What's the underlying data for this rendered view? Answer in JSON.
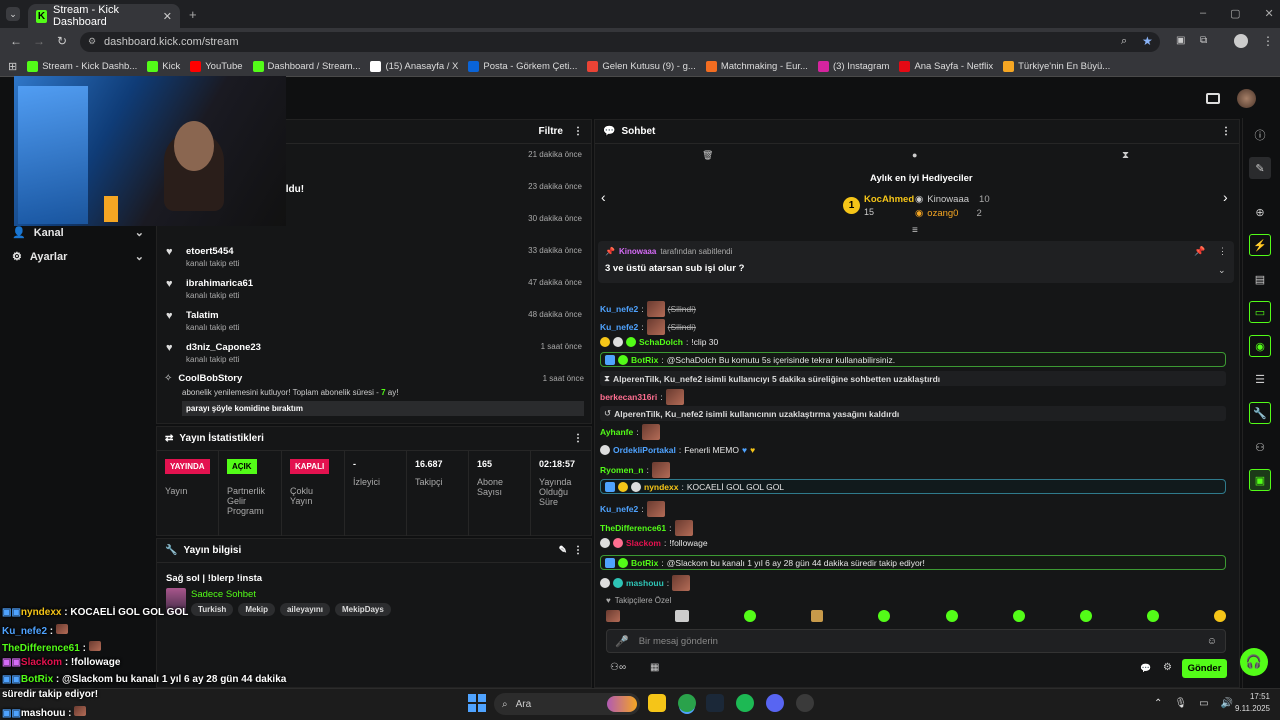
{
  "browser": {
    "tab_title": "Stream - Kick Dashboard",
    "url": "dashboard.kick.com/stream",
    "bookmarks": [
      {
        "label": "Stream - Kick Dashb...",
        "color": "#53fc18"
      },
      {
        "label": "Kick",
        "color": "#53fc18"
      },
      {
        "label": "YouTube",
        "color": "#ff0000"
      },
      {
        "label": "Dashboard / Stream...",
        "color": "#53fc18"
      },
      {
        "label": "(15) Anasayfa / X",
        "color": "#ffffff"
      },
      {
        "label": "Posta - Görkem Çeti...",
        "color": "#0a64d8"
      },
      {
        "label": "Gelen Kutusu (9) - g...",
        "color": "#ea4335"
      },
      {
        "label": "Matchmaking - Eur...",
        "color": "#f36d21"
      },
      {
        "label": "(3) Instagram",
        "color": "#d6249f"
      },
      {
        "label": "Ana Sayfa - Netflix",
        "color": "#e50914"
      },
      {
        "label": "Türkiye'nin En Büyü...",
        "color": "#f5a623"
      }
    ]
  },
  "sidebar": {
    "items": [
      {
        "label": "Kanal"
      },
      {
        "label": "Ayarlar"
      }
    ]
  },
  "activity": {
    "filter_label": "Filtre",
    "partial_title": "ıldu!",
    "rows": [
      {
        "user": "",
        "sub": "",
        "time": "21 dakika önce"
      },
      {
        "user": "",
        "sub": "",
        "time": "23 dakika önce"
      },
      {
        "user": "",
        "sub": "kanalı takip etti",
        "time": "30 dakika önce"
      },
      {
        "user": "etoert5454",
        "sub": "kanalı takip etti",
        "time": "33 dakika önce"
      },
      {
        "user": "ibrahimarica61",
        "sub": "kanalı takip etti",
        "time": "47 dakika önce"
      },
      {
        "user": "Talatim",
        "sub": "kanalı takip etti",
        "time": "48 dakika önce"
      },
      {
        "user": "d3niz_Capone23",
        "sub": "kanalı takip etti",
        "time": "1 saat önce"
      }
    ],
    "sub_row": {
      "user": "CoolBobStory",
      "text": "abonelik yenilemesini kutluyor! Toplam abonelik süresi - ",
      "months": "7",
      "suffix": " ay!",
      "time": "1 saat önce",
      "message": "parayı şöyle komidine bıraktım"
    }
  },
  "stats": {
    "title": "Yayın İstatistikleri",
    "cols": [
      {
        "badge": "YAYINDA",
        "label": "Yayın",
        "color": "#e3124f"
      },
      {
        "badge": "AÇIK",
        "label": "Partnerlik Gelir Programı",
        "color": "#53fc18"
      },
      {
        "badge": "KAPALI",
        "label": "Çoklu Yayın",
        "color": "#e3124f"
      },
      {
        "value": "-",
        "label": "İzleyici"
      },
      {
        "value": "16.687",
        "label": "Takipçi"
      },
      {
        "value": "165",
        "label": "Abone Sayısı"
      },
      {
        "value": "02:18:57",
        "label": "Yayında Olduğu Süre"
      }
    ]
  },
  "stream_info": {
    "title": "Yayın bilgisi",
    "stream_title": "Sağ sol | !blerp !insta",
    "category": "Sadece Sohbet",
    "tags": [
      "Turkish",
      "Mekip",
      "aileyayını",
      "MekipDays"
    ]
  },
  "chat": {
    "title": "Sohbet",
    "gifters_title": "Aylık en iyi Hediyeciler",
    "top_gifter": {
      "name": "KocAhmed",
      "count": "15",
      "rank": "1"
    },
    "gifter2": {
      "name": "Kinowaaa",
      "count": "10"
    },
    "gifter3": {
      "name": "ozang0",
      "count": "2"
    },
    "pinned_by": "Kinowaaa",
    "pinned_suffix": "tarafından sabitlendi",
    "pinned_text": "3 ve üstü atarsan sub işi olur ?",
    "deleted_label": "(Silindi)",
    "msgs": {
      "k1": "Ku_nefe2",
      "scha_user": "SchaDolch",
      "scha_text": "!clip 30",
      "botrix": "BotRix",
      "botrix1": "@SchaDolch Bu komutu 5s içerisinde tekrar kullanabilirsiniz.",
      "timeout_text": "AlperenTilk, Ku_nefe2 isimli kullanıcıyı 5 dakika süreliğine sohbetten uzaklaştırdı",
      "berke": "berkecan316ri",
      "untimeout_text": "AlperenTilk, Ku_nefe2 isimli kullanıcının uzaklaştırma yasağını kaldırdı",
      "ayhan": "Ayhanfe",
      "ordek_user": "OrdekliPortakal",
      "ordek_text": "Fenerli MEMO",
      "ryomen": "Ryomen_n",
      "nyndexx_user": "nyndexx",
      "nyndexx_text": "KOCAELİ GOL GOL GOL",
      "kunefe": "Ku_nefe2",
      "thedif": "TheDifference61",
      "slackom_user": "Slackom",
      "slackom_text": "!followage",
      "botrix2": "@Slackom bu kanalı 1 yıl 6 ay 28 gün 44 dakika süredir takip ediyor!",
      "mashouu": "mashouu"
    },
    "followers_only": "Takipçilere Özel",
    "input_placeholder": "Bir mesaj gönderin",
    "send_label": "Gönder"
  },
  "overlay": {
    "lines": [
      {
        "user": "nyndexx",
        "text": " : KOCAELİ GOL GOL GOL",
        "color": "#f5c518"
      },
      {
        "user": "Ku_nefe2",
        "text": " :",
        "color": "#4fa3ff"
      },
      {
        "user": "TheDifference61",
        "text": " :",
        "color": "#53fc18"
      },
      {
        "user": "Slackom",
        "text": " : !followage",
        "color": "#e3124f"
      },
      {
        "user": "BotRix",
        "text": " : @Slackom bu kanalı 1 yıl 6 ay 28 gün 44 dakika",
        "color": "#53fc18"
      },
      {
        "user": "",
        "text": "süredir takip ediyor!",
        "color": "#ffffff"
      },
      {
        "user": "mashouu",
        "text": " :",
        "color": "#fff"
      }
    ]
  },
  "taskbar": {
    "search": "Ara",
    "time": "17:51",
    "date": "9.11.2025"
  }
}
